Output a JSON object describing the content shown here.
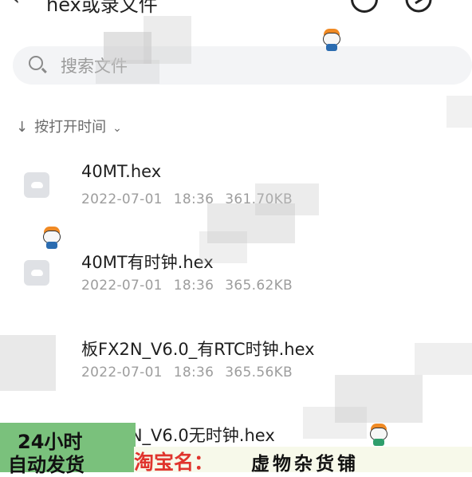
{
  "header": {
    "back_icon": "back-arrow-icon",
    "title": "hex或录文件",
    "history_icon": "clock-icon",
    "share_icon": "share-icon"
  },
  "search": {
    "placeholder_text": "搜索文件"
  },
  "sort": {
    "label": "按打开时间"
  },
  "files": [
    {
      "name": "40MT.hex",
      "date": "2022-07-01",
      "time": "18:36",
      "size": "361.70KB",
      "icon": "file-icon"
    },
    {
      "name": "40MT有时钟.hex",
      "date": "2022-07-01",
      "time": "18:36",
      "size": "365.62KB",
      "icon": "file-icon"
    },
    {
      "name": "板FX2N_V6.0_有RTC时钟.hex",
      "date": "2022-07-01",
      "time": "18:36",
      "size": "365.56KB",
      "icon": "file-icon"
    },
    {
      "name": "板FX2N_V6.0无时钟.hex",
      "date": "",
      "time": "",
      "size": "",
      "icon": "file-icon"
    }
  ],
  "promo": {
    "badge_line1": "24小时",
    "badge_line2": "自动发货",
    "store_label": "淘宝名：",
    "store_name": "虚物杂货铺",
    "badge_color": "#7ac17c",
    "label_color": "#e0342d"
  }
}
